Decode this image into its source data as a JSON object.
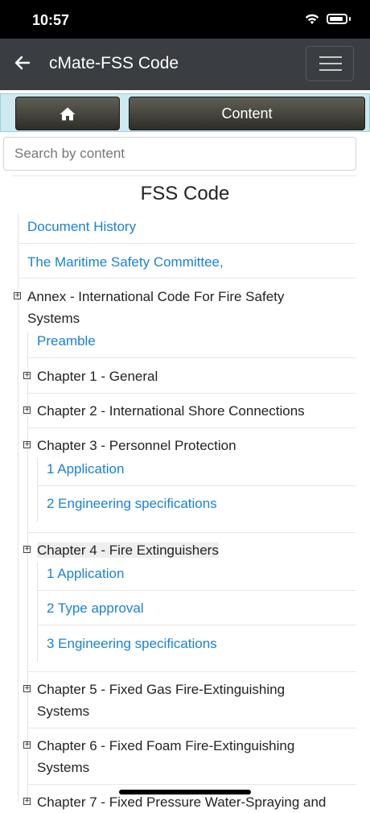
{
  "status": {
    "time": "10:57"
  },
  "app": {
    "title": "cMate-FSS Code"
  },
  "toolbar": {
    "content_label": "Content"
  },
  "search": {
    "placeholder": "Search by content"
  },
  "document": {
    "title": "FSS Code"
  },
  "toc": {
    "document_history": "Document History",
    "msc": "The Maritime Safety Committee,",
    "annex_line1": "Annex - International Code For Fire Safety",
    "annex_line2": "Systems",
    "preamble": "Preamble",
    "ch1": "Chapter 1 - General",
    "ch2": "Chapter 2 - International Shore Connections",
    "ch3": "Chapter 3 - Personnel Protection",
    "ch3_items": [
      "1 Application",
      "2 Engineering specifications"
    ],
    "ch4": "Chapter 4 - Fire Extinguishers",
    "ch4_items": [
      "1 Application",
      "2 Type approval",
      "3 Engineering specifications"
    ],
    "ch5_line1": "Chapter 5 - Fixed Gas Fire-Extinguishing",
    "ch5_line2": "Systems",
    "ch6_line1": "Chapter 6 - Fixed Foam Fire-Extinguishing",
    "ch6_line2": "Systems",
    "ch7_partial": "Chapter 7 - Fixed Pressure Water-Spraying and"
  },
  "icons": {
    "back": "back-arrow-icon",
    "menu": "hamburger-menu-icon",
    "home": "home-icon",
    "expand": "expand-plus-icon",
    "wifi": "wifi-icon",
    "battery": "battery-icon"
  }
}
